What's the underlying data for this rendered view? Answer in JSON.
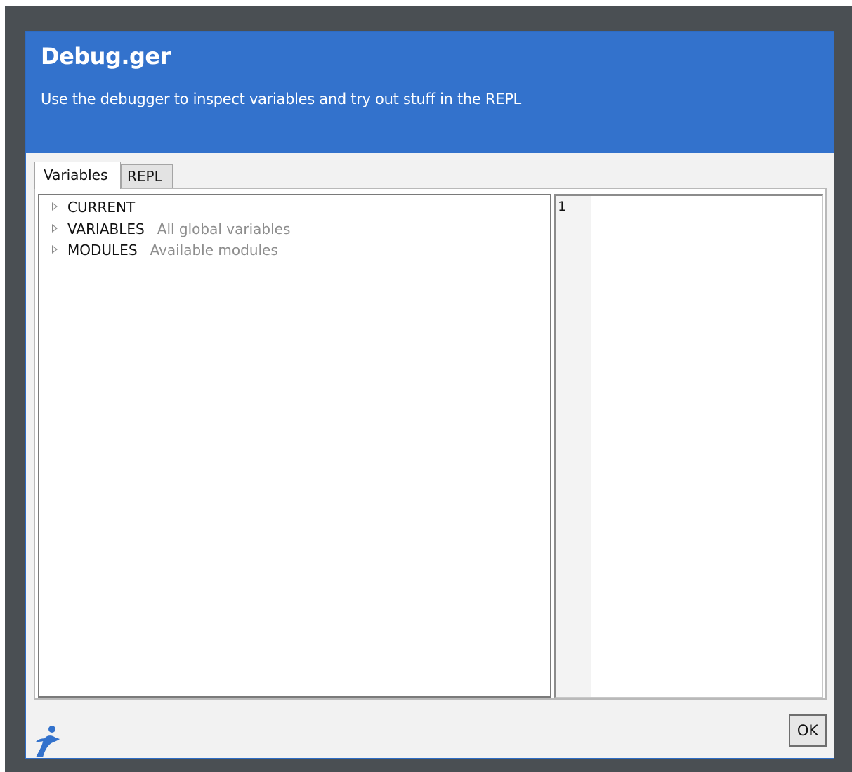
{
  "dialog": {
    "title": "Debug.ger",
    "subtitle": "Use the debugger to inspect variables and try out stuff in the REPL",
    "header_color": "#3372cc"
  },
  "tabs": [
    {
      "label": "Variables",
      "active": true
    },
    {
      "label": "REPL",
      "active": false
    }
  ],
  "tree": {
    "items": [
      {
        "name": "CURRENT",
        "description": "",
        "expanded": false
      },
      {
        "name": "VARIABLES",
        "description": "All global variables",
        "expanded": false
      },
      {
        "name": "MODULES",
        "description": "Available modules",
        "expanded": false
      }
    ]
  },
  "editor": {
    "line_numbers": [
      "1"
    ]
  },
  "footer": {
    "ok_label": "OK",
    "logo_icon": "app-logo-icon"
  }
}
